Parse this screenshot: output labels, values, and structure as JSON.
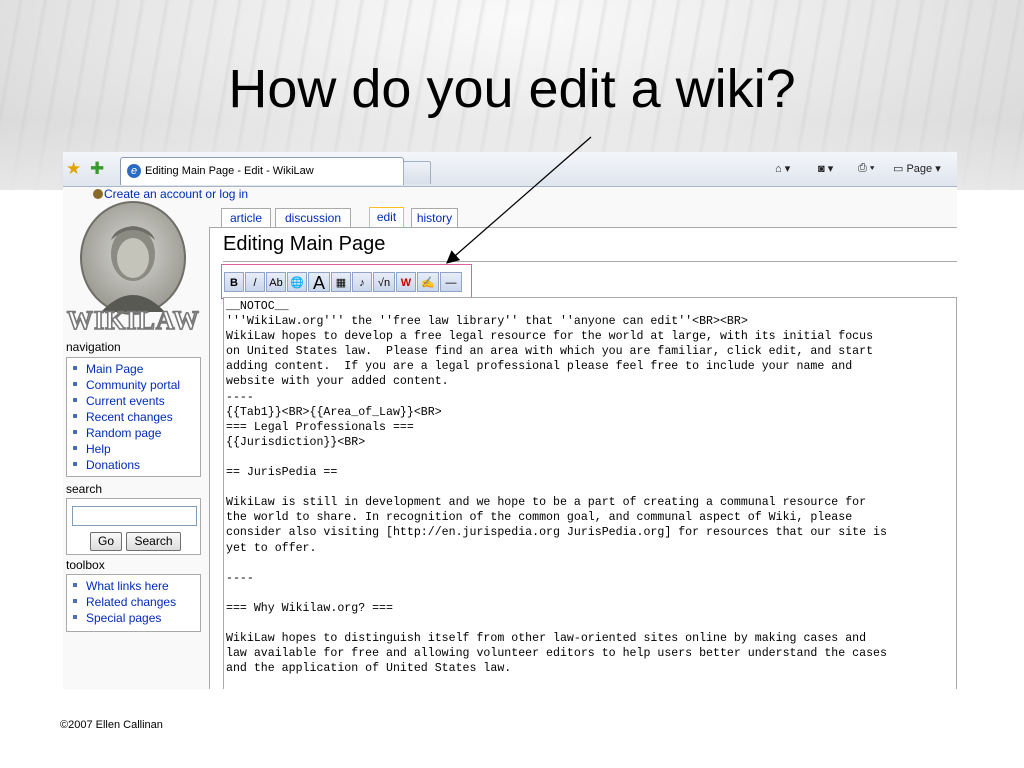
{
  "slide": {
    "title": "How do you edit a wiki?",
    "copyright": "©2007 Ellen Callinan"
  },
  "browser": {
    "tab_title": "Editing Main Page - Edit - WikiLaw",
    "home_icon": "home-icon",
    "feeds_icon": "feeds-icon",
    "print_icon": "print-icon",
    "page_menu_label": "Page"
  },
  "wiki": {
    "login_text": "Create an account or log in",
    "logo_text": "WIKILAW",
    "page_tabs": [
      {
        "label": "article",
        "active": false
      },
      {
        "label": "discussion",
        "active": false
      },
      {
        "label": "edit",
        "active": true
      },
      {
        "label": "history",
        "active": false
      }
    ],
    "page_heading": "Editing Main Page",
    "navigation": {
      "heading": "navigation",
      "items": [
        "Main Page",
        "Community portal",
        "Current events",
        "Recent changes",
        "Random page",
        "Help",
        "Donations"
      ]
    },
    "search": {
      "heading": "search",
      "go_label": "Go",
      "search_label": "Search",
      "value": ""
    },
    "toolbox": {
      "heading": "toolbox",
      "items": [
        "What links here",
        "Related changes",
        "Special pages"
      ]
    },
    "edit_toolbar": [
      {
        "icon": "bold-icon",
        "glyph": "B"
      },
      {
        "icon": "italic-icon",
        "glyph": "/"
      },
      {
        "icon": "internal-link-icon",
        "glyph": "Ab"
      },
      {
        "icon": "external-link-icon",
        "glyph": "🌐"
      },
      {
        "icon": "headline-icon",
        "glyph": "A"
      },
      {
        "icon": "embedded-image-icon",
        "glyph": "▦"
      },
      {
        "icon": "media-file-icon",
        "glyph": "♪"
      },
      {
        "icon": "math-formula-icon",
        "glyph": "√n"
      },
      {
        "icon": "nowiki-icon",
        "glyph": "W"
      },
      {
        "icon": "signature-icon",
        "glyph": "✍"
      },
      {
        "icon": "horizontal-line-icon",
        "glyph": "—"
      }
    ],
    "editor_lines": [
      "__NOTOC__",
      "'''WikiLaw.org''' the ''free law library'' that ''anyone can edit''<BR><BR>",
      "WikiLaw hopes to develop a free legal resource for the world at large, with its initial focus",
      "on United States law.  Please find an area with which you are familiar, click edit, and start",
      "adding content.  If you are a legal professional please feel free to include your name and",
      "website with your added content.",
      "----",
      "{{Tab1}}<BR>{{Area_of_Law}}<BR>",
      "=== Legal Professionals ===",
      "{{Jurisdiction}}<BR>",
      "",
      "== JurisPedia ==",
      "",
      "WikiLaw is still in development and we hope to be a part of creating a communal resource for",
      "the world to share. In recognition of the common goal, and communal aspect of Wiki, please",
      "consider also visiting [http://en.jurispedia.org JurisPedia.org] for resources that our site is",
      "yet to offer.",
      "",
      "----",
      "",
      "=== Why Wikilaw.org? ===",
      "",
      "WikiLaw hopes to distinguish itself from other law-oriented sites online by making cases and",
      "law available for free and allowing volunteer editors to help users better understand the cases",
      "and the application of United States law."
    ],
    "summary_label": "-"
  }
}
